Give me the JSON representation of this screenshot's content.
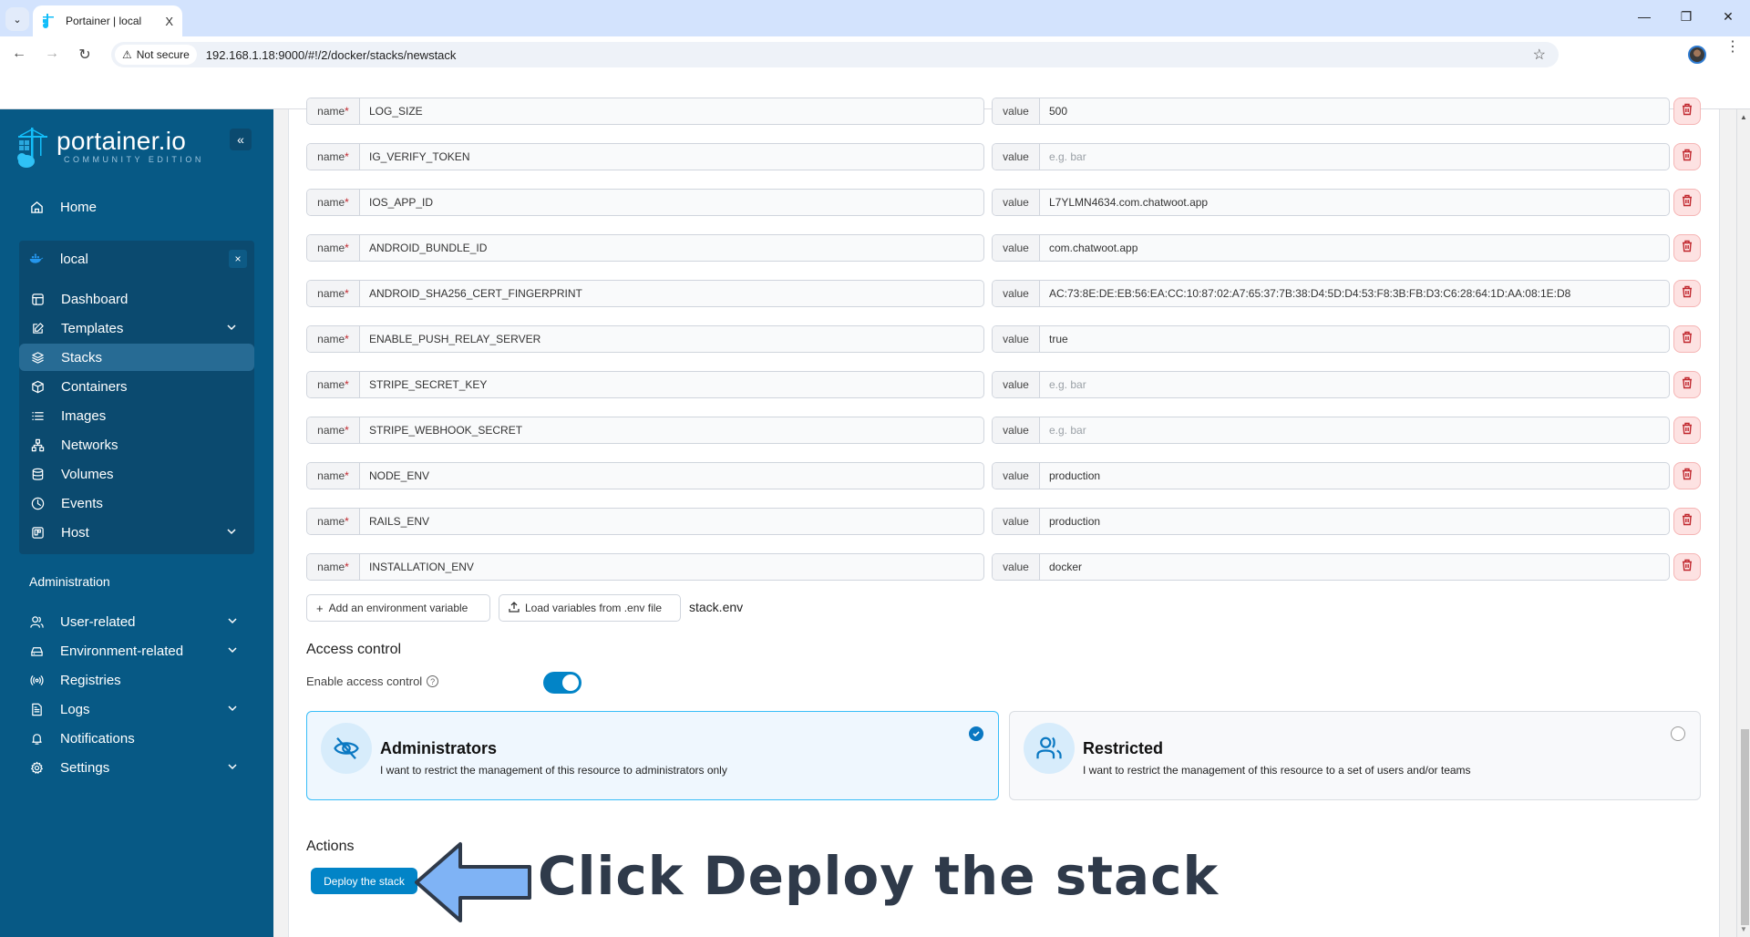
{
  "browser": {
    "tab_title": "Portainer | local",
    "tab_close": "X",
    "not_secure_label": "Not secure",
    "url": "192.168.1.18:9000/#!/2/docker/stacks/newstack",
    "minimize": "—",
    "restore": "❐",
    "close": "✕",
    "back": "←",
    "forward": "→",
    "reload": "↻",
    "star": "☆",
    "kebab": "⋮",
    "tab_search": "⌄"
  },
  "sidebar": {
    "logo_main": "portainer.io",
    "logo_sub": "COMMUNITY EDITION",
    "collapse": "«",
    "home": "Home",
    "environment": {
      "name": "local",
      "close": "×"
    },
    "env_items": [
      {
        "label": "Dashboard",
        "icon": "dashboard-icon",
        "chevron": false
      },
      {
        "label": "Templates",
        "icon": "edit-icon",
        "chevron": true
      },
      {
        "label": "Stacks",
        "icon": "layers-icon",
        "chevron": false,
        "active": true
      },
      {
        "label": "Containers",
        "icon": "box-icon",
        "chevron": false
      },
      {
        "label": "Images",
        "icon": "list-icon",
        "chevron": false
      },
      {
        "label": "Networks",
        "icon": "network-icon",
        "chevron": false
      },
      {
        "label": "Volumes",
        "icon": "database-icon",
        "chevron": false
      },
      {
        "label": "Events",
        "icon": "clock-icon",
        "chevron": false
      },
      {
        "label": "Host",
        "icon": "host-icon",
        "chevron": true
      }
    ],
    "admin_title": "Administration",
    "admin_items": [
      {
        "label": "User-related",
        "icon": "users-icon",
        "chevron": true
      },
      {
        "label": "Environment-related",
        "icon": "drive-icon",
        "chevron": true
      },
      {
        "label": "Registries",
        "icon": "radio-icon",
        "chevron": false
      },
      {
        "label": "Logs",
        "icon": "file-icon",
        "chevron": true
      },
      {
        "label": "Notifications",
        "icon": "bell-icon",
        "chevron": false
      },
      {
        "label": "Settings",
        "icon": "gear-icon",
        "chevron": true
      }
    ]
  },
  "env_vars": {
    "name_label": "name",
    "required_mark": "*",
    "value_label": "value",
    "value_placeholder": "e.g. bar",
    "rows": [
      {
        "name": "LOG_SIZE",
        "value": "500"
      },
      {
        "name": "IG_VERIFY_TOKEN",
        "value": ""
      },
      {
        "name": "IOS_APP_ID",
        "value": "L7YLMN4634.com.chatwoot.app"
      },
      {
        "name": "ANDROID_BUNDLE_ID",
        "value": "com.chatwoot.app"
      },
      {
        "name": "ANDROID_SHA256_CERT_FINGERPRINT",
        "value": "AC:73:8E:DE:EB:56:EA:CC:10:87:02:A7:65:37:7B:38:D4:5D:D4:53:F8:3B:FB:D3:C6:28:64:1D:AA:08:1E:D8"
      },
      {
        "name": "ENABLE_PUSH_RELAY_SERVER",
        "value": "true"
      },
      {
        "name": "STRIPE_SECRET_KEY",
        "value": ""
      },
      {
        "name": "STRIPE_WEBHOOK_SECRET",
        "value": ""
      },
      {
        "name": "NODE_ENV",
        "value": "production"
      },
      {
        "name": "RAILS_ENV",
        "value": "production"
      },
      {
        "name": "INSTALLATION_ENV",
        "value": "docker"
      }
    ],
    "add_button": "Add an environment variable",
    "load_button": "Load variables from .env file",
    "loaded_file": "stack.env"
  },
  "access_control": {
    "title": "Access control",
    "toggle_label": "Enable access control",
    "toggle_on": true,
    "options": [
      {
        "title": "Administrators",
        "description": "I want to restrict the management of this resource to administrators only",
        "selected": true
      },
      {
        "title": "Restricted",
        "description": "I want to restrict the management of this resource to a set of users and/or teams",
        "selected": false
      }
    ]
  },
  "actions": {
    "title": "Actions",
    "deploy_button": "Deploy the stack"
  },
  "annotation": {
    "text": "Click Deploy the stack"
  },
  "colors": {
    "sidebar_bg": "#075985",
    "accent": "#0284c7",
    "danger": "#c0262d"
  }
}
